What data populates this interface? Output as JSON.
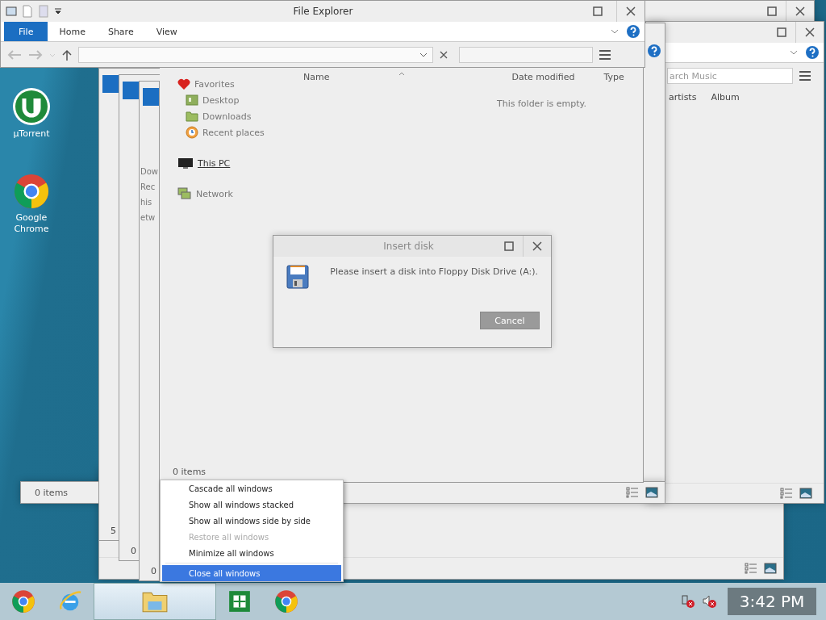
{
  "desktop_icons": [
    {
      "label": "µTorrent",
      "kind": "torrent"
    },
    {
      "label": "Google Chrome",
      "kind": "chrome"
    }
  ],
  "music_window": {
    "search": {
      "placeholder": "arch Music"
    },
    "columns": [
      "artists",
      "Album"
    ]
  },
  "middle_window": {
    "status": "0 items"
  },
  "cascade_windows": [
    {
      "status": "5"
    },
    {
      "status": "0"
    },
    {
      "nav_items": [
        "Dow",
        "Rec",
        "his",
        "etw"
      ],
      "status": "0"
    }
  ],
  "explorer": {
    "title": "File Explorer",
    "tabs": [
      {
        "label": "File",
        "selected": true
      },
      {
        "label": "Home",
        "selected": false
      },
      {
        "label": "Share",
        "selected": false
      },
      {
        "label": "View",
        "selected": false
      }
    ],
    "nav": [
      {
        "label": "Favorites",
        "kind": "favorites",
        "hovered": false,
        "children": [
          {
            "label": "Desktop",
            "kind": "desktop",
            "hovered": false
          },
          {
            "label": "Downloads",
            "kind": "downloads",
            "hovered": false
          },
          {
            "label": "Recent places",
            "kind": "recent",
            "hovered": false
          }
        ]
      },
      {
        "label": "This PC",
        "kind": "pc",
        "hovered": true
      },
      {
        "label": "Network",
        "kind": "network",
        "hovered": false
      }
    ],
    "columns": [
      "Name",
      "Date modified",
      "Type"
    ],
    "empty_message": "This folder is empty.",
    "status": "0 items"
  },
  "dialog": {
    "title": "Insert disk",
    "message": "Please insert a disk into Floppy Disk Drive (A:).",
    "button": "Cancel"
  },
  "context_menu": {
    "items": [
      {
        "label": "Cascade all windows",
        "disabled": false,
        "selected": false
      },
      {
        "label": "Show all windows stacked",
        "disabled": false,
        "selected": false
      },
      {
        "label": "Show all windows side by side",
        "disabled": false,
        "selected": false
      },
      {
        "label": "Restore all windows",
        "disabled": true,
        "selected": false
      },
      {
        "label": "Minimize all windows",
        "disabled": false,
        "selected": false
      },
      {
        "label": "Close all windows",
        "disabled": false,
        "selected": true
      }
    ]
  },
  "taskbar": {
    "apps": [
      {
        "kind": "chrome",
        "active": false
      },
      {
        "kind": "ie",
        "active": false
      },
      {
        "kind": "explorer",
        "active": true
      },
      {
        "kind": "sheet",
        "active": false
      },
      {
        "kind": "chrome",
        "active": false
      }
    ],
    "clock": "3:42 PM"
  }
}
